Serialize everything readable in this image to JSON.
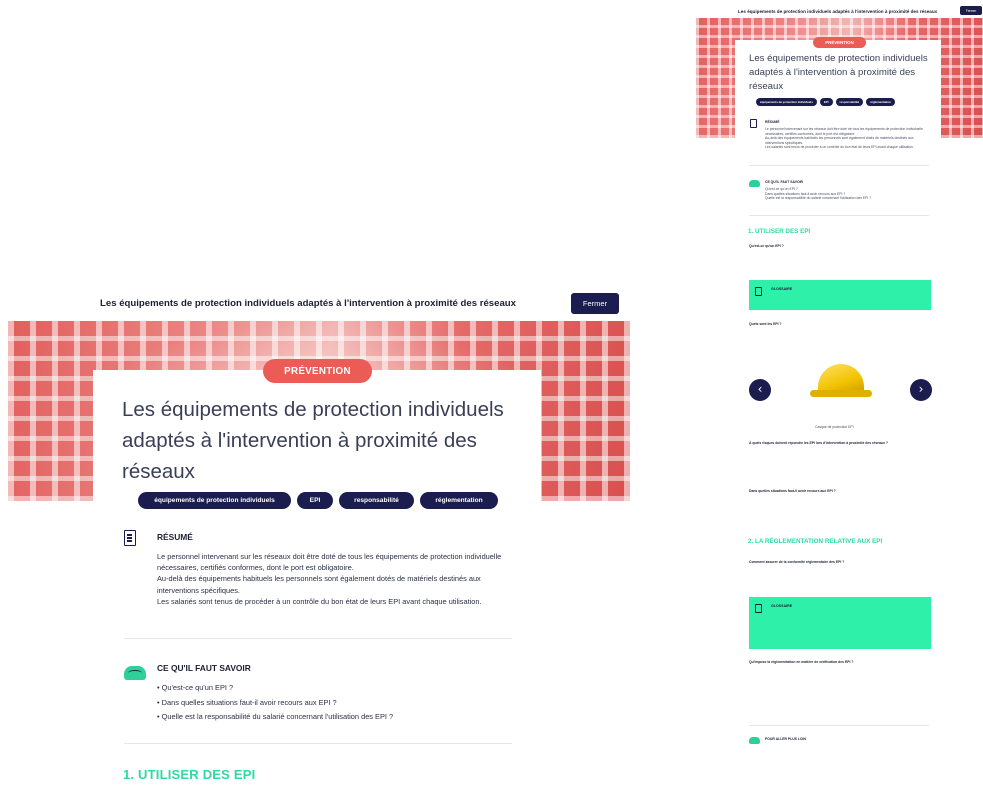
{
  "header": {
    "title": "Les équipements de protection individuels adaptés à l'intervention à proximité des réseaux",
    "close_label": "Fermer"
  },
  "article": {
    "category": "PRÉVENTION",
    "title": "Les équipements de protection individuels adaptés à l'intervention à proximité des réseaux",
    "tags": [
      "équipements de protection individuels",
      "EPI",
      "responsabilité",
      "réglementation"
    ],
    "resume": {
      "title": "RÉSUMÉ",
      "lines": [
        "Le personnel intervenant sur les réseaux doit être doté de tous les équipements de protection individuelle nécessaires, certifiés conformes, dont le port est obligatoire.",
        "Au-delà des équipements habituels les personnels sont également dotés de matériels destinés aux interventions spécifiques.",
        "Les salariés sont tenus de procéder à un contrôle du bon état de leurs EPI avant chaque utilisation."
      ]
    },
    "savoir": {
      "title": "CE QU'IL FAUT SAVOIR",
      "items": [
        "Qu'est-ce qu'un EPI ?",
        "Dans quelles situations faut-il avoir recours aux EPI ?",
        "Quelle est la responsabilité du salarié concernant l'utilisation des EPI ?"
      ]
    },
    "section1": "1. UTILISER DES EPI",
    "section2": "2. LA RÉGLEMENTATION RELATIVE AUX EPI",
    "glossaire": "GLOSSAIRE",
    "q1": "Qu'est-ce qu'un EPI ?",
    "q2": "Quels sont les EPI ?",
    "q3": "À quels risques doivent répondre les EPI lors d'intervention à proximité des réseaux ?",
    "q4": "Dans quelles situations faut-il avoir recours aux EPI ?",
    "q5": "Comment assurer de la conformité réglementaire des EPI ?",
    "q6": "Qu'impose la réglementation en matière de vérification des EPI ?",
    "image_caption": "Casque de protection EPI",
    "more": "POUR ALLER PLUS LOIN",
    "prev_arrow": "‹",
    "next_arrow": "›"
  },
  "colors": {
    "navy": "#1a1d4e",
    "coral": "#ea5c55",
    "mint": "#2fd9a3",
    "glossary_bg": "#2ff0a8"
  }
}
